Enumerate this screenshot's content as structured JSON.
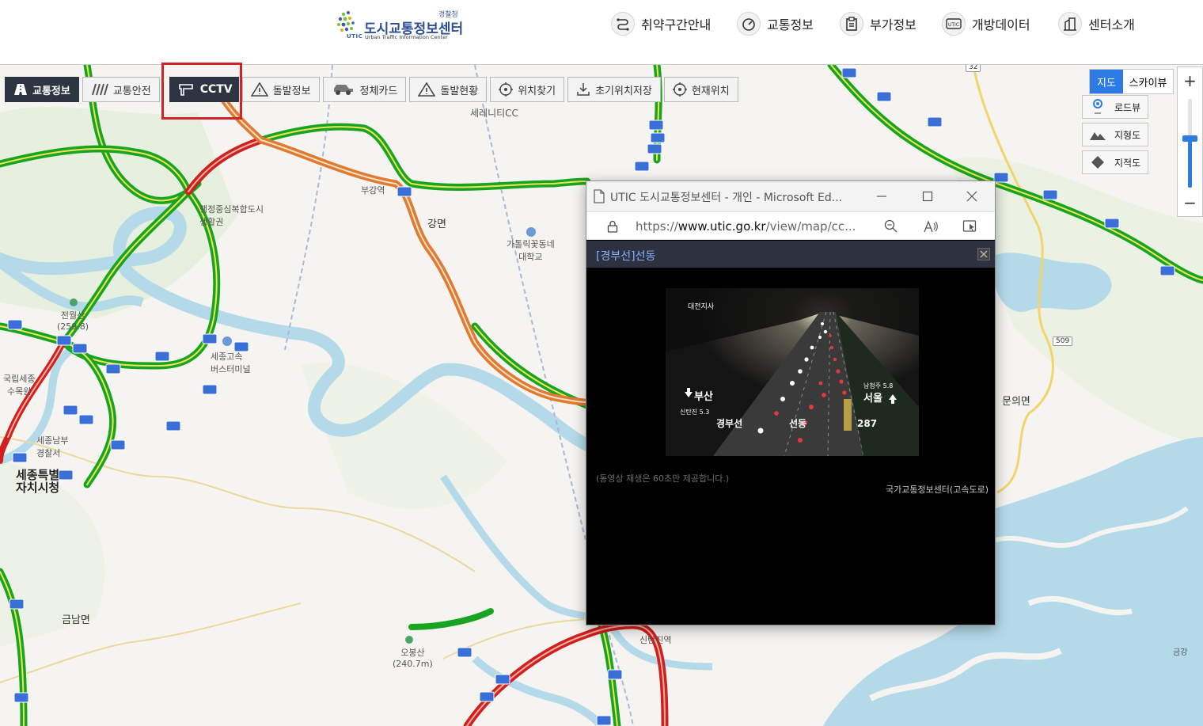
{
  "header": {
    "logo": {
      "agency": "경찰청",
      "title": "도시교통정보센터",
      "subtitle": "Urban Traffic Information Center",
      "mark": "UTIC"
    },
    "nav": [
      {
        "label": "취약구간안내",
        "icon": "route-icon"
      },
      {
        "label": "교통정보",
        "icon": "speedometer-icon"
      },
      {
        "label": "부가정보",
        "icon": "clipboard-icon"
      },
      {
        "label": "개방데이터",
        "icon": "utic-data-icon"
      },
      {
        "label": "센터소개",
        "icon": "building-icon"
      }
    ]
  },
  "toolbar": {
    "traffic_info": "교통정보",
    "traffic_safety": "교통안전",
    "cctv": "CCTV",
    "incident_info": "돌발정보",
    "congestion_card": "정체카드",
    "incident_status": "돌발현황",
    "find_location": "위치찾기",
    "save_initial": "초기위치저장",
    "current_location": "현재위치"
  },
  "map_controls": {
    "map_type": {
      "map": "지도",
      "skyview": "스카이뷰",
      "selected": "지도"
    },
    "layers": [
      "로드뷰",
      "지형도",
      "지적도"
    ],
    "zoom_in": "+",
    "zoom_out": "−",
    "zoom_level_fraction": 0.47
  },
  "map_labels": {
    "serenity_cc": "세레니티CC",
    "gangmyeon": "강면",
    "catholic_univ": "가톨릭꽃동네\n대학교",
    "jeonwolsan": "전월산\n(259.8)",
    "sejong_terminal": "세종고속\n버스터미널",
    "gukrip_sejong": "국립세종\n수목원",
    "sejong_south_police": "세종남부\n경찰서",
    "sejong_city_hall": "세종특별\n자치시청",
    "multi_city": "행정중심복합도시\n생활권",
    "bugang": "부강역",
    "geumnam": "금남면",
    "obongsan": "오봉산\n(240.7m)",
    "munui": "문의면",
    "sintanjin": "신탄진역",
    "geumgang": "금강",
    "road_32": "32",
    "road_509": "509"
  },
  "popup": {
    "window_title": "UTIC 도시교통정보센터 - 개인 - Microsoft Ed...",
    "url_prefix": "https://",
    "url_domain": "www.utic.go.kr",
    "url_rest": "/view/map/cc...",
    "camera_title": "[경부선]선동",
    "notice": "(동영상 재생은 60초만 제공합니다.)",
    "source": "국가교통정보센터(고속도로)",
    "video": {
      "overlay_top": "대전지사",
      "left_dir": "부산",
      "left_sub": "신탄진  5.3",
      "right_dir": "서울",
      "right_sub": "남청주  5.8",
      "road": "경부선",
      "place": "선동",
      "km": "287"
    }
  },
  "colors": {
    "toolbar_dark": "#2d3542",
    "highlight": "#d0232a",
    "accent_blue": "#2d7be5",
    "road_green": "#17a521",
    "road_red": "#d11e1e",
    "road_orange": "#e07a30",
    "water": "#b4dae9"
  }
}
